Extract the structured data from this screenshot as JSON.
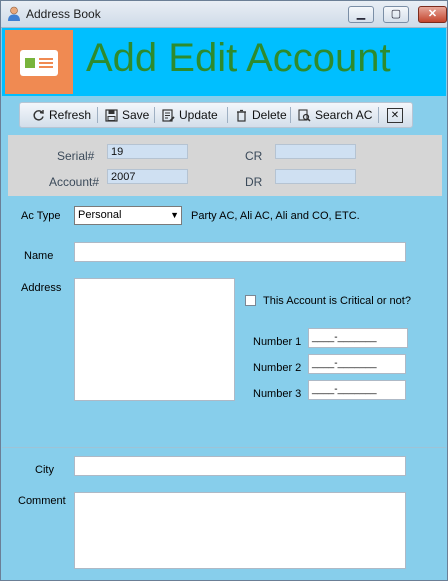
{
  "window": {
    "title": "Address Book"
  },
  "window_controls": {
    "minimize": "▁",
    "maximize": "▢",
    "close": "✕"
  },
  "header": {
    "title": "Add Edit Account"
  },
  "toolbar": {
    "refresh": "Refresh",
    "save": "Save",
    "update": "Update",
    "delete": "Delete",
    "search": "Search AC",
    "close": "✕"
  },
  "info": {
    "serial_label": "Serial#",
    "serial_value": "19",
    "account_label": "Account#",
    "account_value": "2007",
    "cr_label": "CR",
    "cr_value": "",
    "dr_label": "DR",
    "dr_value": ""
  },
  "form": {
    "ac_type_label": "Ac Type",
    "ac_type_value": "Personal",
    "ac_type_hint": "Party AC, Ali AC, Ali and CO, ETC.",
    "name_label": "Name",
    "name_value": "",
    "address_label": "Address",
    "address_value": "",
    "critical_label": "This Account is Critical or not?",
    "number1_label": "Number 1",
    "number1_value": "____-_______",
    "number2_label": "Number 2",
    "number2_value": "____-_______",
    "number3_label": "Number 3",
    "number3_value": "____-_______",
    "city_label": "City",
    "city_value": "",
    "comment_label": "Comment",
    "comment_value": ""
  },
  "colors": {
    "form_bg": "#87ceeb",
    "banner_bg": "#00bfff",
    "title_green": "#2e8b2e",
    "logo_orange": "#f08a52"
  }
}
